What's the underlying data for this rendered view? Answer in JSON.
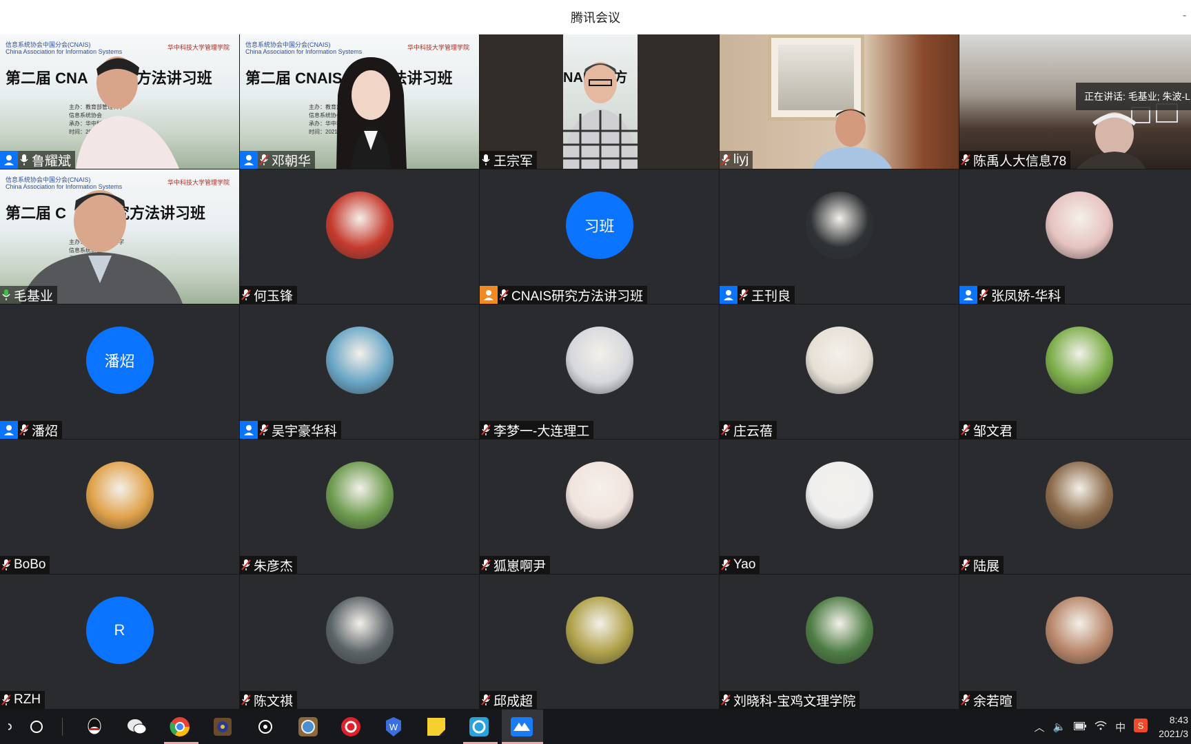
{
  "window": {
    "title": "腾讯会议"
  },
  "speaking_banner": "正在讲话: 毛基业; 朱波-L",
  "slide": {
    "org_cn": "信息系统协会中国分会(CNAIS)",
    "org_en": "China Association for Information Systems",
    "univ": "华中科技大学管理学院",
    "title": "第二届 CNAIS 研究方法讲习班",
    "title_partial_1": "第二届 CNA",
    "title_partial_1b": "方法讲习班",
    "title_partial_2": "第二届 C",
    "title_partial_2b": "究方法讲习班",
    "title_partial_3": "NAIS 究方",
    "lines": [
      "主办：教育部管理科学",
      "信息系统协会",
      "承办：华中科技大",
      "时间：2021年3月"
    ]
  },
  "participants": [
    {
      "name": "鲁耀斌",
      "host": true,
      "mic": "on",
      "type": "video-slide"
    },
    {
      "name": "邓朝华",
      "host": true,
      "mic": "muted",
      "type": "video-slide"
    },
    {
      "name": "王宗军",
      "host": false,
      "mic": "on",
      "type": "video-narrow"
    },
    {
      "name": "liyj",
      "host": false,
      "mic": "muted",
      "type": "video-room"
    },
    {
      "name": "陈禹人大信息78",
      "host": false,
      "mic": "muted",
      "type": "video-dark"
    },
    {
      "name": "毛基业",
      "host": false,
      "mic": "speaking",
      "type": "video-slide",
      "active": true
    },
    {
      "name": "何玉锋",
      "host": false,
      "mic": "muted",
      "type": "avatar",
      "avatar_color": "#c63b2f"
    },
    {
      "name": "CNAIS研究方法讲习班",
      "host": true,
      "host_color": "orange",
      "mic": "muted",
      "type": "avatar-text",
      "avatar_text": "习班"
    },
    {
      "name": "王刊良",
      "host": true,
      "mic": "muted",
      "type": "avatar",
      "avatar_color": "#2e3235"
    },
    {
      "name": "张凤娇-华科",
      "host": true,
      "mic": "muted",
      "type": "avatar",
      "avatar_color": "#e7c3c0"
    },
    {
      "name": "潘炤",
      "host": true,
      "mic": "muted",
      "type": "avatar-text",
      "avatar_text": "潘炤"
    },
    {
      "name": "吴宇豪华科",
      "host": true,
      "mic": "muted",
      "type": "avatar",
      "avatar_color": "#6aa6c5"
    },
    {
      "name": "李梦一-大连理工",
      "host": false,
      "mic": "muted",
      "type": "avatar",
      "avatar_color": "#d6d8dd"
    },
    {
      "name": "庄云蓓",
      "host": false,
      "mic": "muted",
      "type": "avatar",
      "avatar_color": "#e6e0d6"
    },
    {
      "name": "邹文君",
      "host": false,
      "mic": "muted",
      "type": "avatar",
      "avatar_color": "#7cae4a"
    },
    {
      "name": "BoBo",
      "host": false,
      "mic": "muted",
      "type": "avatar",
      "avatar_color": "#e0a24a"
    },
    {
      "name": "朱彦杰",
      "host": false,
      "mic": "muted",
      "type": "avatar",
      "avatar_color": "#6c9b4e"
    },
    {
      "name": "狐崽啊尹",
      "host": false,
      "mic": "muted",
      "type": "avatar",
      "avatar_color": "#f2e4df"
    },
    {
      "name": "Yao",
      "host": false,
      "mic": "muted",
      "type": "avatar",
      "avatar_color": "#efefef"
    },
    {
      "name": "陆展",
      "host": false,
      "mic": "muted",
      "type": "avatar",
      "avatar_color": "#8c6b4b"
    },
    {
      "name": "RZH",
      "host": false,
      "mic": "muted",
      "type": "avatar-text",
      "avatar_text": "R"
    },
    {
      "name": "陈文祺",
      "host": false,
      "mic": "muted",
      "type": "avatar",
      "avatar_color": "#5c6468"
    },
    {
      "name": "邱成超",
      "host": false,
      "mic": "muted",
      "type": "avatar",
      "avatar_color": "#b0a24a"
    },
    {
      "name": "刘晓科-宝鸡文理学院",
      "host": false,
      "mic": "muted",
      "type": "avatar",
      "avatar_color": "#4e7d45"
    },
    {
      "name": "余若暄",
      "host": false,
      "mic": "muted",
      "type": "avatar",
      "avatar_color": "#b8866a"
    }
  ],
  "taskbar": {
    "clock_time": "8:43",
    "clock_date": "2021/3",
    "ime": "中",
    "icons": [
      "search-icon",
      "taskview-icon",
      "qq-icon",
      "wechat-icon",
      "chrome-icon",
      "game-icon",
      "media-icon",
      "settings-icon",
      "netease-music-icon",
      "wps-icon",
      "sticky-notes-icon",
      "app-icon",
      "tencent-meeting-icon"
    ]
  },
  "colors": {
    "accent": "#0a74ff",
    "speaking": "#3bc14a",
    "muted": "#d9342b"
  }
}
